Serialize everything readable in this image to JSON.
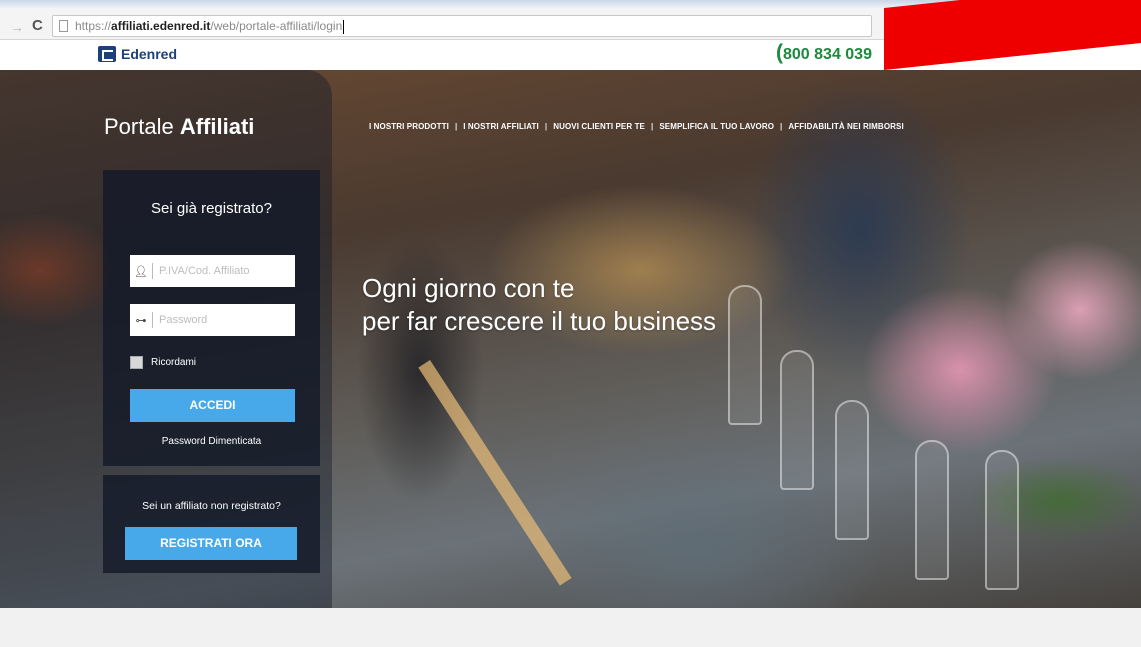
{
  "browser": {
    "url_scheme": "https://",
    "url_host": "affiliati.edenred.it",
    "url_path": "/web/portale-affiliati/login",
    "forward_icon": "forward-arrow-icon",
    "reload_icon": "reload-icon"
  },
  "header": {
    "brand": "Edenred",
    "phone": "800 834 039",
    "redaction_color": "#ee0000"
  },
  "hero": {
    "portal_title_light": "Portale ",
    "portal_title_bold": "Affiliati",
    "nav": [
      "I NOSTRI PRODOTTI",
      "I NOSTRI AFFILIATI",
      "NUOVI CLIENTI PER TE",
      "SEMPLIFICA IL TUO LAVORO",
      "AFFIDABILITÀ NEI RIMBORSI"
    ],
    "tagline_line1": "Ogni giorno con te",
    "tagline_line2": "per far crescere il tuo business"
  },
  "login": {
    "title": "Sei già registrato?",
    "username_placeholder": "P.IVA/Cod. Affiliato",
    "password_placeholder": "Password",
    "remember_label": "Ricordami",
    "submit_label": "ACCEDI",
    "forgot_label": "Password Dimenticata"
  },
  "register": {
    "question": "Sei un affiliato non registrato?",
    "button_label": "REGISTRATI ORA"
  },
  "colors": {
    "accent_blue": "#47a9ea",
    "brand_navy": "#1f3f7a",
    "phone_green": "#1b8a3c"
  }
}
